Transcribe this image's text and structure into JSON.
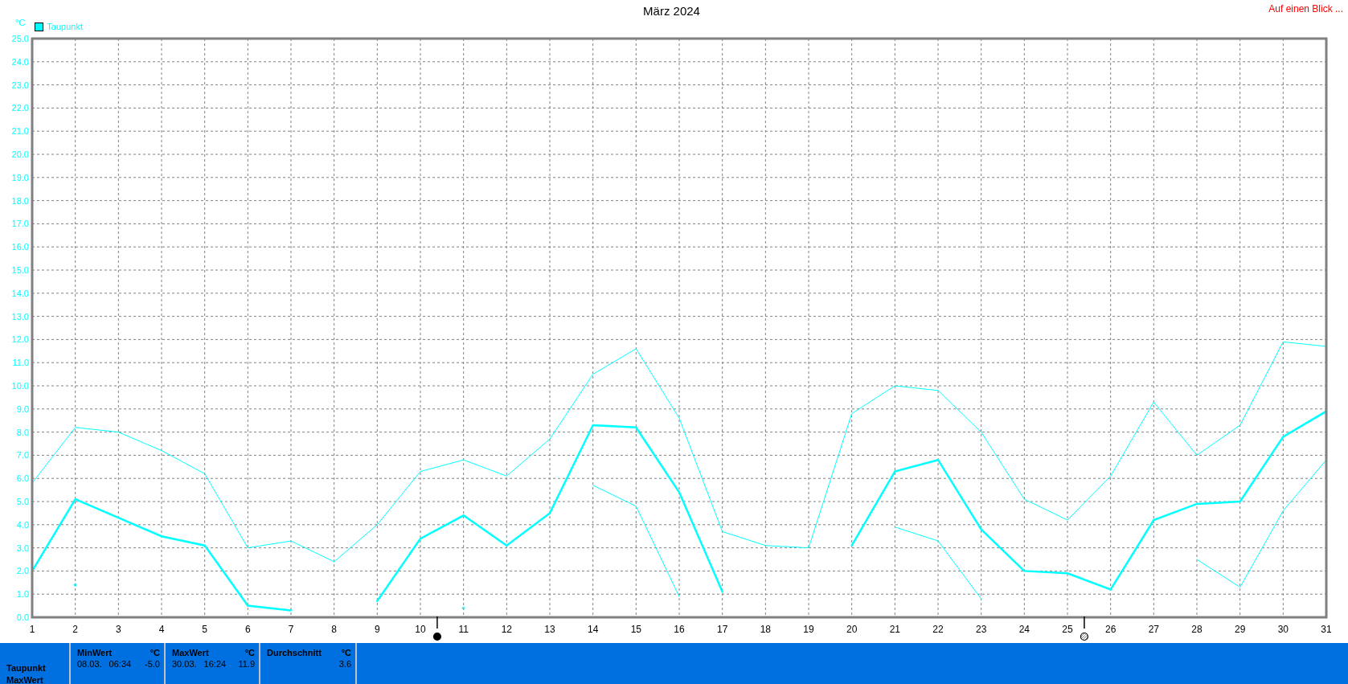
{
  "title": "März 2024",
  "top_link": "Auf einen Blick ...",
  "legend": {
    "label": "Taupunkt",
    "color": "#00ffff"
  },
  "chart_data": {
    "type": "line",
    "grid": true,
    "ylabel": "°C",
    "xlim": [
      1,
      31
    ],
    "ylim": [
      0,
      25
    ],
    "x": [
      1,
      2,
      3,
      4,
      5,
      6,
      7,
      8,
      9,
      10,
      11,
      12,
      13,
      14,
      15,
      16,
      17,
      18,
      19,
      20,
      21,
      22,
      23,
      24,
      25,
      26,
      27,
      28,
      29,
      30,
      31
    ],
    "xticks": [
      1,
      2,
      3,
      4,
      5,
      6,
      7,
      8,
      9,
      10,
      11,
      12,
      13,
      14,
      15,
      16,
      17,
      18,
      19,
      20,
      21,
      22,
      23,
      24,
      25,
      26,
      27,
      28,
      29,
      30,
      31
    ],
    "yticks": [
      {
        "value": 0,
        "label": "0.0"
      },
      {
        "value": 1,
        "label": "1.0"
      },
      {
        "value": 2,
        "label": "2.0"
      },
      {
        "value": 3,
        "label": "3.0"
      },
      {
        "value": 4,
        "label": "4.0"
      },
      {
        "value": 5,
        "label": "5.0"
      },
      {
        "value": 6,
        "label": "6.0"
      },
      {
        "value": 7,
        "label": "7.0"
      },
      {
        "value": 8,
        "label": "8.0"
      },
      {
        "value": 9,
        "label": "9.0"
      },
      {
        "value": 10,
        "label": "10.0"
      },
      {
        "value": 11,
        "label": "11.0"
      },
      {
        "value": 12,
        "label": "12.0"
      },
      {
        "value": 13,
        "label": "13.0"
      },
      {
        "value": 14,
        "label": "14.0"
      },
      {
        "value": 15,
        "label": "15.0"
      },
      {
        "value": 16,
        "label": "16.0"
      },
      {
        "value": 17,
        "label": "17.0"
      },
      {
        "value": 18,
        "label": "18.0"
      },
      {
        "value": 19,
        "label": "19.0"
      },
      {
        "value": 20,
        "label": "20.0"
      },
      {
        "value": 21,
        "label": "21.0"
      },
      {
        "value": 22,
        "label": "22.0"
      },
      {
        "value": 23,
        "label": "23.0"
      },
      {
        "value": 24,
        "label": "24.0"
      },
      {
        "value": 25,
        "label": "25.0"
      }
    ],
    "series": [
      {
        "color": "#00ffff",
        "values": [
          5.8,
          8.2,
          8.0,
          7.2,
          6.2,
          3.0,
          3.3,
          2.4,
          4.0,
          6.3,
          6.8,
          6.1,
          7.7,
          10.5,
          11.6,
          8.6,
          3.7,
          3.1,
          3.0,
          8.8,
          10.0,
          9.8,
          8.0,
          5.1,
          4.2,
          6.1,
          9.3,
          7.0,
          8.3,
          11.9,
          11.7
        ]
      },
      {
        "color": "#00ffff",
        "values": [
          2.0,
          5.1,
          4.3,
          3.5,
          3.1,
          0.5,
          0.3,
          null,
          0.7,
          3.4,
          4.4,
          3.1,
          4.5,
          8.3,
          8.2,
          5.4,
          1.1,
          null,
          null,
          3.1,
          6.3,
          6.8,
          3.8,
          2.0,
          1.9,
          1.2,
          4.2,
          4.9,
          5.0,
          7.8,
          8.9
        ]
      },
      {
        "color": "#00ffff",
        "values": [
          null,
          1.4,
          null,
          null,
          null,
          null,
          null,
          null,
          null,
          null,
          0.4,
          null,
          null,
          5.7,
          4.8,
          0.9,
          null,
          null,
          null,
          null,
          3.9,
          3.3,
          0.8,
          null,
          null,
          null,
          null,
          2.5,
          1.3,
          4.6,
          6.8
        ]
      }
    ]
  },
  "moon_phases": [
    {
      "kind": "new_moon",
      "level": 0.313
    },
    {
      "kind": "full_moon",
      "level": 0.813
    }
  ],
  "stats": {
    "row_labels": [
      "Taupunkt",
      "MaxWert"
    ],
    "columns": [
      {
        "header": "MinWert",
        "unit": "°C",
        "date": "08.03.",
        "time": "06:34",
        "value": "-5.0"
      },
      {
        "header": "MaxWert",
        "unit": "°C",
        "date": "30.03.",
        "time": "16:24",
        "value": "11.9"
      },
      {
        "header": "Durchschnitt",
        "unit": "°C",
        "value": "3.6"
      }
    ]
  }
}
